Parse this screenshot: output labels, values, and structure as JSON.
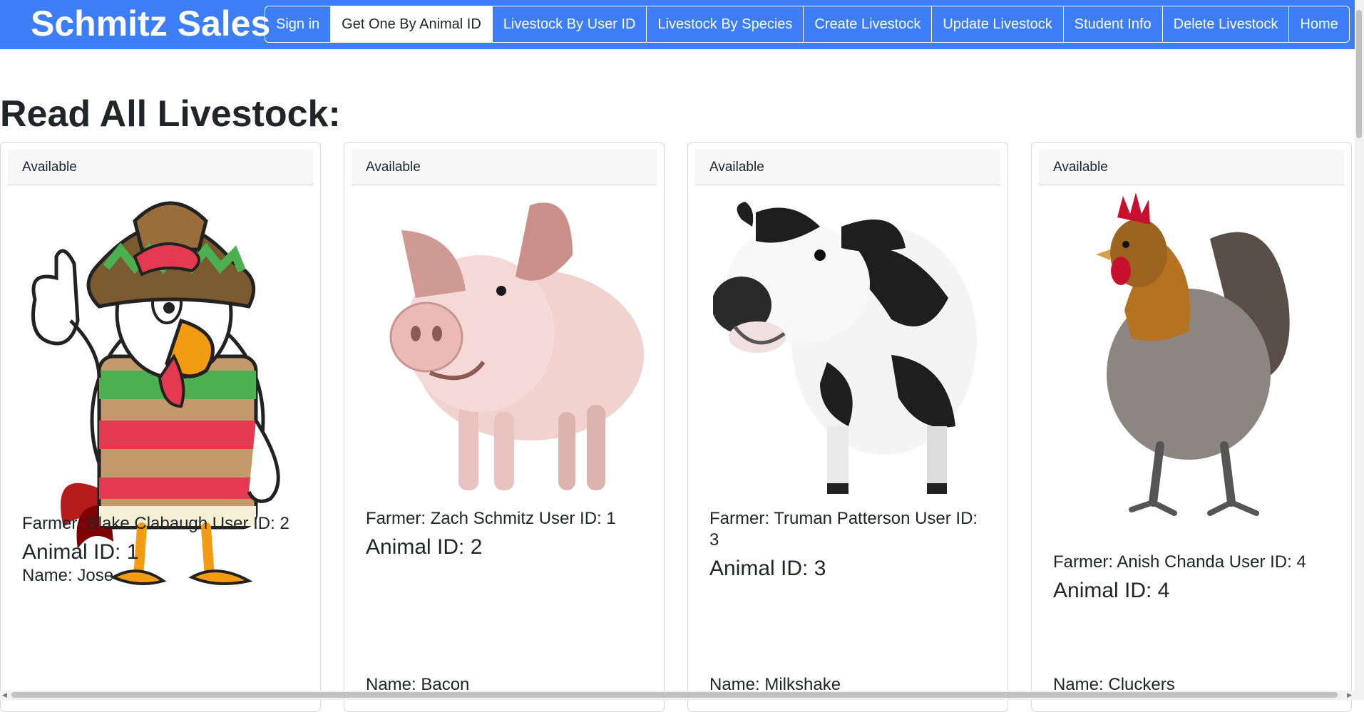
{
  "navbar": {
    "brand": "Schmitz Sales",
    "buttons": [
      {
        "label": "Sign in"
      },
      {
        "label": "Get One By Animal ID",
        "active": true
      },
      {
        "label": "Livestock By User ID"
      },
      {
        "label": "Livestock By Species"
      },
      {
        "label": "Create Livestock"
      },
      {
        "label": "Update Livestock"
      },
      {
        "label": "Student Info"
      },
      {
        "label": "Delete Livestock"
      },
      {
        "label": "Home"
      }
    ]
  },
  "page": {
    "title": "Read All Livestock:"
  },
  "cards": [
    {
      "status": "Available",
      "farmer": "Farmer: Blake Clabaugh User ID: 2",
      "animal_id": "Animal ID: 1",
      "name": "Name: Jose",
      "image": "rooster-sombrero-cartoon"
    },
    {
      "status": "Available",
      "farmer": "Farmer: Zach Schmitz User ID: 1",
      "animal_id": "Animal ID: 2",
      "name": "Name: Bacon",
      "image": "pig"
    },
    {
      "status": "Available",
      "farmer": "Farmer: Truman Patterson User ID: 3",
      "animal_id": "Animal ID: 3",
      "name": "Name: Milkshake",
      "image": "holstein-cow"
    },
    {
      "status": "Available",
      "farmer": "Farmer: Anish Chanda User ID: 4",
      "animal_id": "Animal ID: 4",
      "name": "Name: Cluckers",
      "image": "hen"
    }
  ],
  "colors": {
    "navbar": "#3d7df5",
    "card_header": "#f7f7f7",
    "text": "#212529"
  }
}
